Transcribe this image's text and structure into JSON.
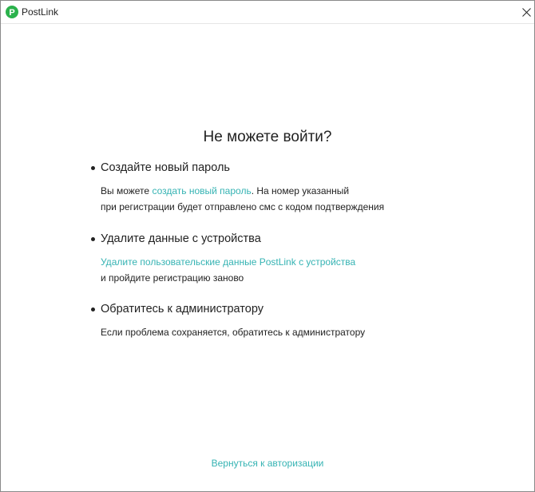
{
  "window": {
    "title": "PostLink",
    "app_icon_letter": "P",
    "close_glyph": "✕",
    "brand_color": "#2bb24c",
    "link_color": "#35b3b3"
  },
  "main": {
    "heading": "Не можете войти?",
    "sections": [
      {
        "title": "Создайте новый пароль",
        "line1_prefix": "Вы можете ",
        "line1_link": "создать новый пароль",
        "line1_suffix": ". На номер указанный",
        "line2": "при регистрации будет отправлено смс с кодом подтверждения"
      },
      {
        "title": "Удалите данные с устройства",
        "link": "Удалите пользовательские данные PostLink с устройства",
        "line2": "и пройдите регистрацию заново"
      },
      {
        "title": "Обратитесь к администратору",
        "line1": "Если проблема сохраняется, обратитесь к администратору"
      }
    ],
    "back_link": "Вернуться к авторизации"
  }
}
